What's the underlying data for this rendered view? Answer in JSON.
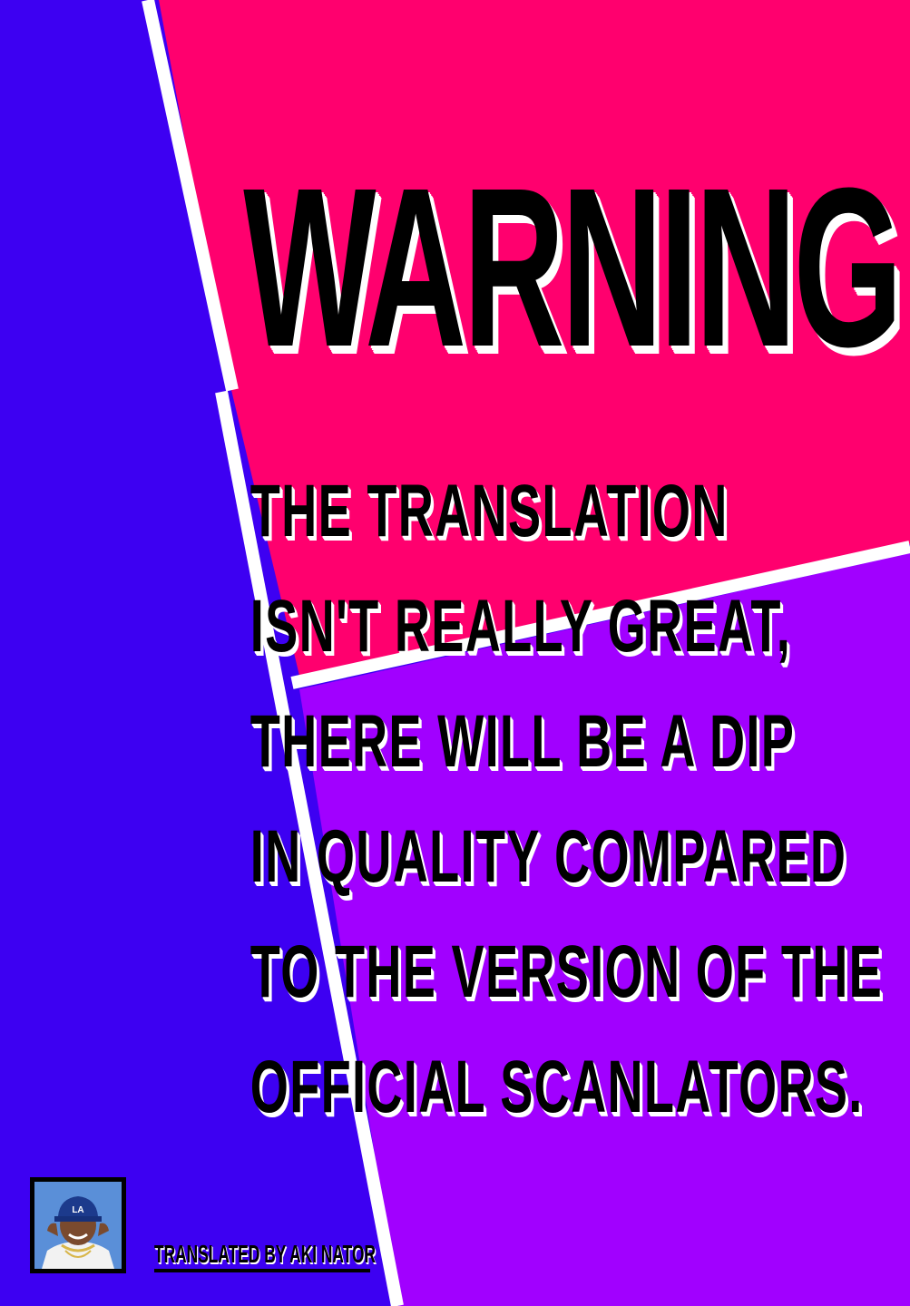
{
  "poster": {
    "title": "WARNING",
    "message_lines": [
      "THE TRANSLATION",
      "ISN'T REALLY GREAT,",
      "THERE WILL BE A DIP",
      "IN QUALITY COMPARED",
      "TO THE VERSION OF THE",
      "OFFICIAL SCANLATORS."
    ],
    "credit": "TRANSLATED BY AKI NATOR",
    "photo_cap_text": "LA"
  },
  "colors": {
    "left_panel": "#3d00f2",
    "top_right_panel": "#ff006e",
    "bottom_right_panel": "#a100ff",
    "divider": "#ffffff",
    "text": "#000000",
    "text_shadow": "#ffffff"
  }
}
